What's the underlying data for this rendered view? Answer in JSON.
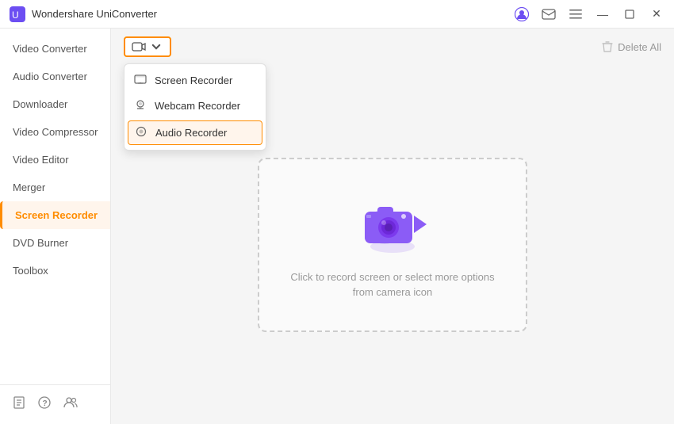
{
  "titleBar": {
    "appName": "Wondershare UniConverter",
    "icons": {
      "profile": "👤",
      "mail": "✉",
      "menu": "☰",
      "minimize": "—",
      "maximize": "☐",
      "close": "✕"
    }
  },
  "sidebar": {
    "items": [
      {
        "id": "video-converter",
        "label": "Video Converter",
        "active": false
      },
      {
        "id": "audio-converter",
        "label": "Audio Converter",
        "active": false
      },
      {
        "id": "downloader",
        "label": "Downloader",
        "active": false
      },
      {
        "id": "video-compressor",
        "label": "Video Compressor",
        "active": false
      },
      {
        "id": "video-editor",
        "label": "Video Editor",
        "active": false
      },
      {
        "id": "merger",
        "label": "Merger",
        "active": false
      },
      {
        "id": "screen-recorder",
        "label": "Screen Recorder",
        "active": true
      },
      {
        "id": "dvd-burner",
        "label": "DVD Burner",
        "active": false
      },
      {
        "id": "toolbox",
        "label": "Toolbox",
        "active": false
      }
    ],
    "footer": {
      "book": "📖",
      "help": "❓",
      "users": "👥"
    }
  },
  "toolbar": {
    "cameraButton": "📹",
    "deleteAll": "Delete All"
  },
  "dropdown": {
    "items": [
      {
        "id": "screen-recorder",
        "label": "Screen Recorder",
        "icon": "🖥"
      },
      {
        "id": "webcam-recorder",
        "label": "Webcam Recorder",
        "icon": "🎦"
      },
      {
        "id": "audio-recorder",
        "label": "Audio Recorder",
        "icon": "🔊",
        "highlighted": true
      }
    ]
  },
  "dropZone": {
    "hint": "Click to record screen or select more options from camera icon"
  }
}
